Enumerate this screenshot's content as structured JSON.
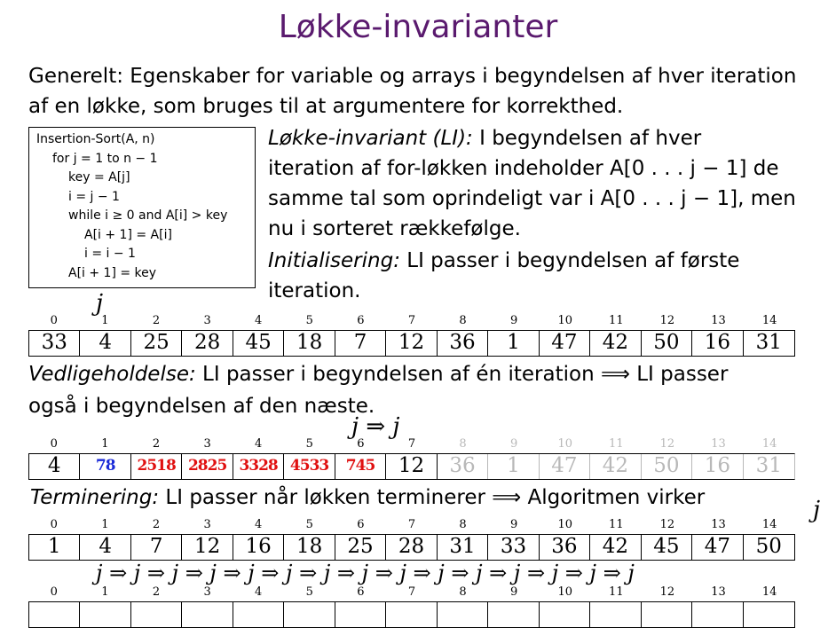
{
  "title": "Løkke-invarianter",
  "intro": {
    "line1": "Generelt: Egenskaber for variable og arrays i begyndelsen af hver iteration",
    "line2": "af en løkke, som bruges til at argumentere for korrekthed."
  },
  "algorithm": {
    "lines": [
      "Insertion-Sort(A, n)",
      "for j = 1 to n − 1",
      "key = A[j]",
      "i = j − 1",
      "while i ≥ 0 and A[i] > key",
      "A[i + 1] = A[i]",
      "i = i − 1",
      "A[i + 1] = key"
    ]
  },
  "invariant": {
    "label": "Løkke-invariant (LI):",
    "l1": "I begyndelsen af hver",
    "l2": "iteration af for-løkken indeholder A[0 . . . j − 1] de",
    "l3": "samme tal som oprindeligt var i A[0 . . . j − 1], men",
    "l4": "nu i sorteret rækkefølge."
  },
  "init": {
    "label": "Initialisering:",
    "l1": "LI passer i begyndelsen af første",
    "l2": "iteration."
  },
  "maintenance": {
    "label": "Vedligeholdelse:",
    "l1": "LI passer i begyndelsen af én iteration ⟹ LI passer",
    "l2": "også i begyndelsen af den næste."
  },
  "termination": {
    "label": "Terminering:",
    "text": "LI passer når løkken terminerer ⟹ Algoritmen virker"
  },
  "indices": [
    "0",
    "1",
    "2",
    "3",
    "4",
    "5",
    "6",
    "7",
    "8",
    "9",
    "10",
    "11",
    "12",
    "13",
    "14"
  ],
  "array1": [
    "33",
    "4",
    "25",
    "28",
    "45",
    "18",
    "7",
    "12",
    "36",
    "1",
    "47",
    "42",
    "50",
    "16",
    "31"
  ],
  "array2": [
    "4",
    "78",
    "2518",
    "2825",
    "3328",
    "4533",
    "745",
    "12",
    "36",
    "1",
    "47",
    "42",
    "50",
    "16",
    "31"
  ],
  "array3": [
    "1",
    "4",
    "7",
    "12",
    "16",
    "18",
    "25",
    "28",
    "31",
    "33",
    "36",
    "42",
    "45",
    "47",
    "50"
  ],
  "array4": [
    "",
    "",
    "",
    "",
    "",
    "",
    "",
    "",
    "",
    "",
    "",
    "",
    "",
    "",
    ""
  ],
  "j_marks": {
    "j1": "j",
    "j2": "j ⇒ j",
    "j3": "j",
    "j4": "j ⇒ j ⇒ j ⇒ j ⇒ j ⇒ j ⇒ j ⇒ j ⇒ j ⇒ j ⇒ j ⇒ j ⇒ j ⇒ j ⇒ j"
  }
}
